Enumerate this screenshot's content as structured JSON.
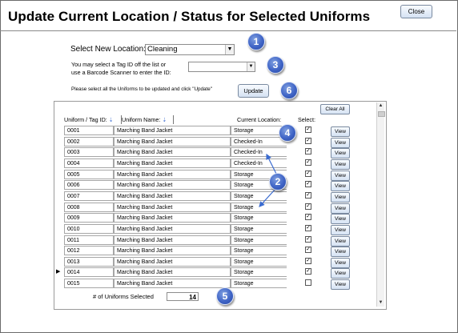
{
  "window": {
    "title": "Update Current Location / Status for Selected Uniforms",
    "close_label": "Close"
  },
  "form": {
    "location_label": "Select New Location:",
    "location_value": "Cleaning",
    "tag_label_line1": "You may select a Tag ID off the list or",
    "tag_label_line2": "use a Barcode Scanner to enter the ID:",
    "tag_value": "",
    "instruction": "Please select all the Uniforms to be updated and click \"Update\"",
    "update_label": "Update"
  },
  "callouts": [
    "1",
    "2",
    "3",
    "4",
    "5",
    "6"
  ],
  "table": {
    "clear_all_label": "Clear All",
    "columns": {
      "tag_id": "Uniform / Tag ID:",
      "name": "Uniform Name:",
      "location": "Current Location:",
      "select": "Select:"
    },
    "view_label": "View",
    "rows": [
      {
        "id": "0001",
        "name": "Marching Band Jacket",
        "location": "Storage",
        "selected": true
      },
      {
        "id": "0002",
        "name": "Marching Band Jacket",
        "location": "Checked-In",
        "selected": true
      },
      {
        "id": "0003",
        "name": "Marching Band Jacket",
        "location": "Checked-In",
        "selected": true
      },
      {
        "id": "0004",
        "name": "Marching Band Jacket",
        "location": "Checked-In",
        "selected": true
      },
      {
        "id": "0005",
        "name": "Marching Band Jacket",
        "location": "Storage",
        "selected": true
      },
      {
        "id": "0006",
        "name": "Marching Band Jacket",
        "location": "Storage",
        "selected": true
      },
      {
        "id": "0007",
        "name": "Marching Band Jacket",
        "location": "Storage",
        "selected": true
      },
      {
        "id": "0008",
        "name": "Marching Band Jacket",
        "location": "Storage",
        "selected": true
      },
      {
        "id": "0009",
        "name": "Marching Band Jacket",
        "location": "Storage",
        "selected": true
      },
      {
        "id": "0010",
        "name": "Marching Band Jacket",
        "location": "Storage",
        "selected": true
      },
      {
        "id": "0011",
        "name": "Marching Band Jacket",
        "location": "Storage",
        "selected": true
      },
      {
        "id": "0012",
        "name": "Marching Band Jacket",
        "location": "Storage",
        "selected": true
      },
      {
        "id": "0013",
        "name": "Marching Band Jacket",
        "location": "Storage",
        "selected": true
      },
      {
        "id": "0014",
        "name": "Marching Band Jacket",
        "location": "Storage",
        "selected": true,
        "current": true
      },
      {
        "id": "0015",
        "name": "Marching Band Jacket",
        "location": "Storage",
        "selected": false
      }
    ]
  },
  "footer": {
    "count_label": "# of Uniforms Selected",
    "count_value": "14"
  },
  "colors": {
    "callout_blue": "#3f64c6",
    "arrow_blue": "#3a6bd0",
    "button_gradient_top": "#f8fbff",
    "button_gradient_bottom": "#d5e2f3"
  }
}
